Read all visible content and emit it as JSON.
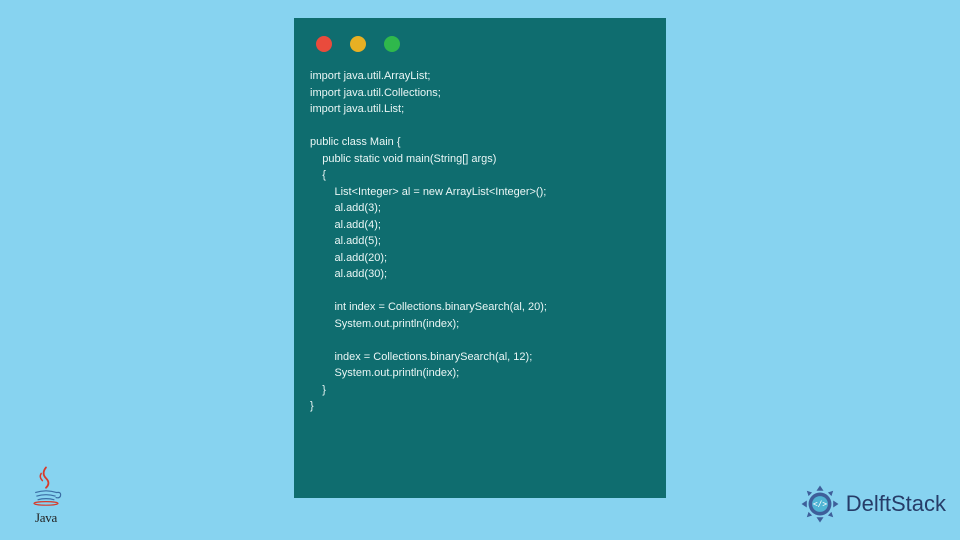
{
  "code": {
    "lines": [
      "import java.util.ArrayList;",
      "import java.util.Collections;",
      "import java.util.List;",
      "",
      "public class Main {",
      "    public static void main(String[] args)",
      "    {",
      "        List<Integer> al = new ArrayList<Integer>();",
      "        al.add(3);",
      "        al.add(4);",
      "        al.add(5);",
      "        al.add(20);",
      "        al.add(30);",
      "",
      "        int index = Collections.binarySearch(al, 20);",
      "        System.out.println(index);",
      "",
      "        index = Collections.binarySearch(al, 12);",
      "        System.out.println(index);",
      "    }",
      "}"
    ]
  },
  "logos": {
    "java": "Java",
    "delftstack": "DelftStack"
  }
}
